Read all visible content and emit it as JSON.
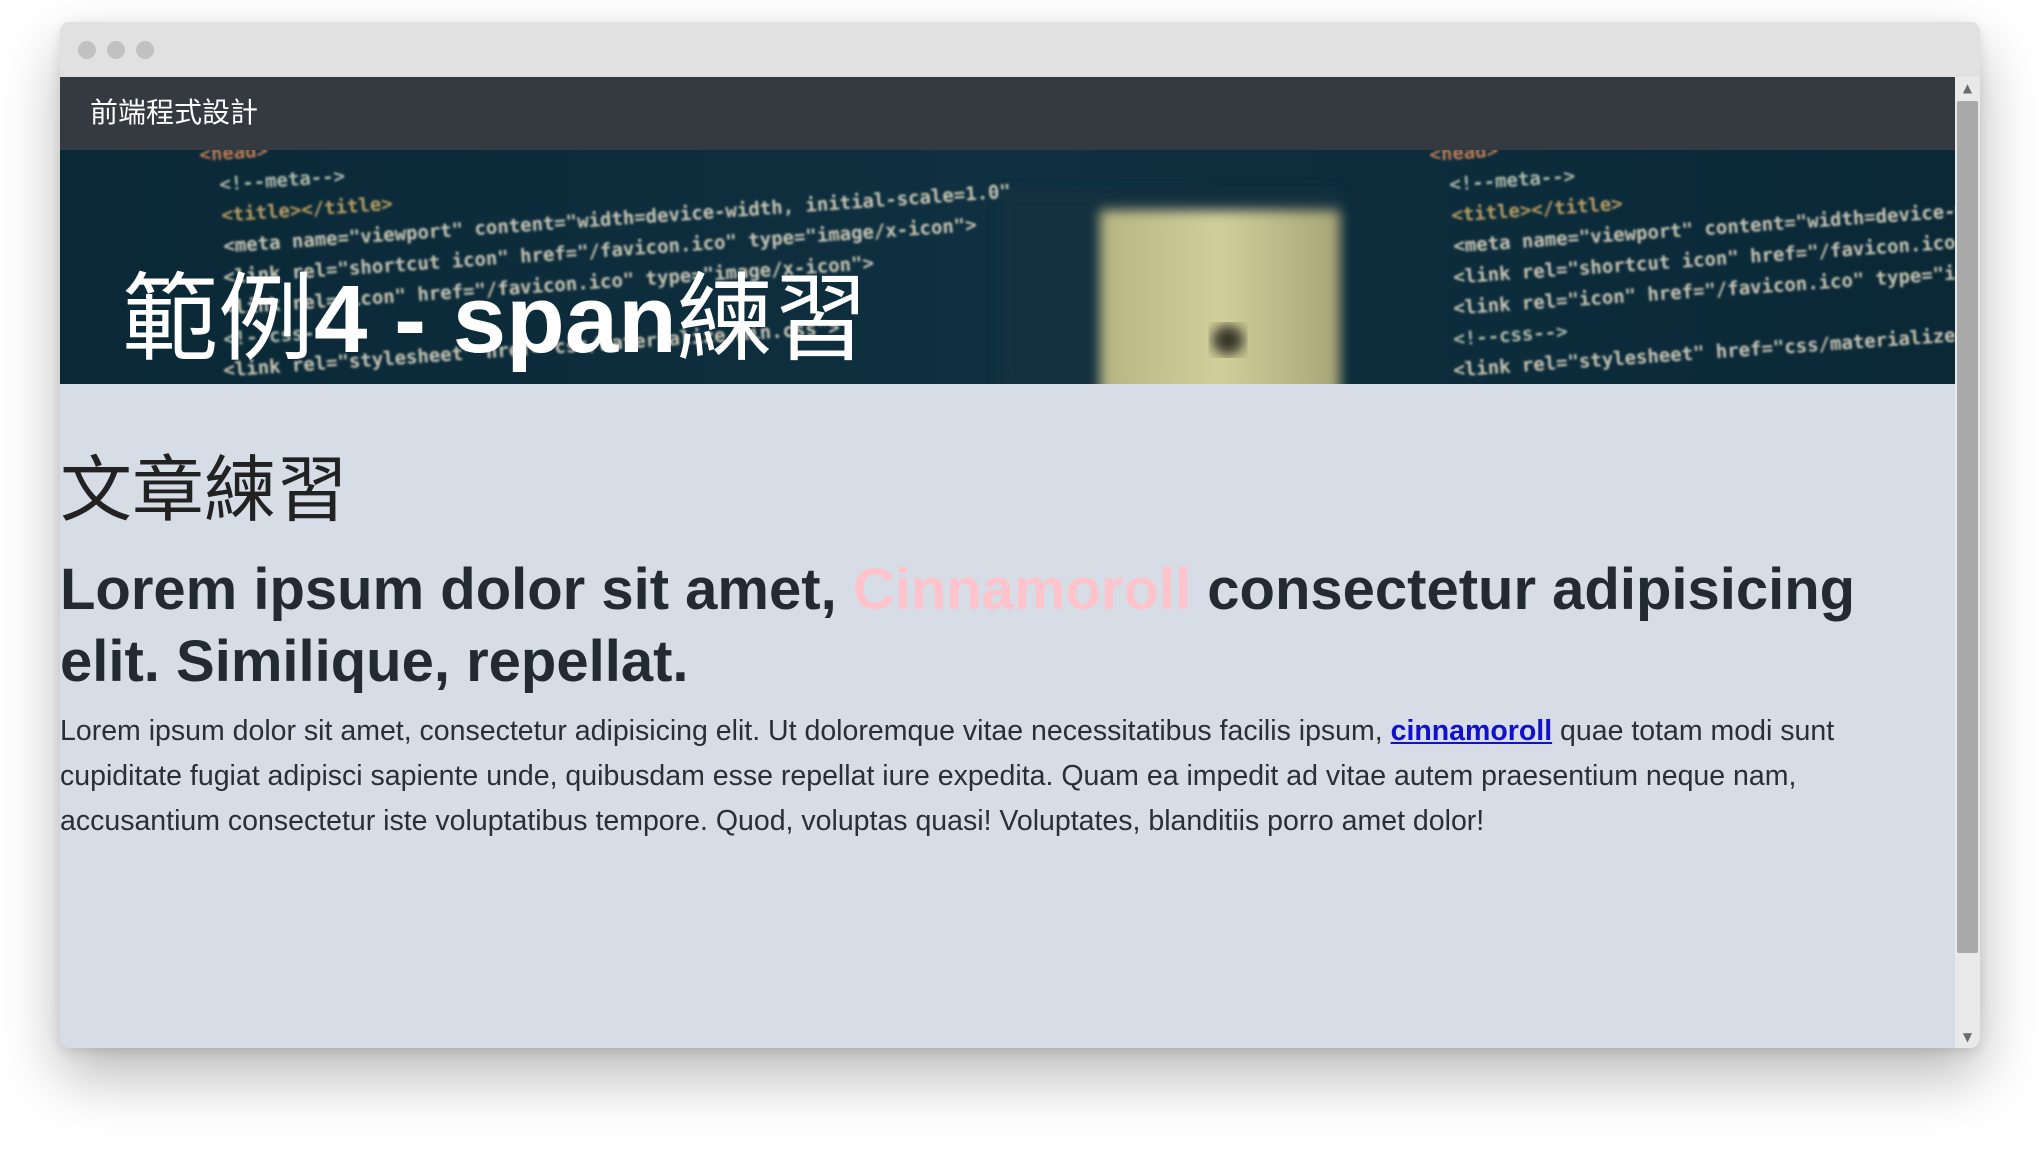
{
  "navbar": {
    "brand": "前端程式設計"
  },
  "hero": {
    "title_prefix": "範例",
    "title_number": "4 - span",
    "title_suffix": "練習"
  },
  "article": {
    "section_title": "文章練習",
    "headline_before": "Lorem ipsum dolor sit amet, ",
    "headline_highlight": "Cinnamoroll",
    "headline_after": " consectetur adipisicing elit. Similique, repellat.",
    "paragraph_before": "Lorem ipsum dolor sit amet, consectetur adipisicing elit. Ut doloremque vitae necessitatibus facilis ipsum, ",
    "paragraph_link": "cinnamoroll",
    "paragraph_after": " quae totam modi sunt cupiditate fugiat adipisci sapiente unde, quibusdam esse repellat iure expedita. Quam ea impedit ad vitae autem praesentium neque nam, accusantium consectetur iste voluptatibus tempore. Quod, voluptas quasi! Voluptates, blanditiis porro amet dolor!"
  },
  "hero_code_snippets": [
    "<head>",
    "<!--meta-->",
    "<title></title>",
    "<meta name=\"viewport\" content=\"width=device-width, initial-scale=1.0\">",
    "<link rel=\"shortcut icon\" href=\"/favicon.ico\" type=\"image/x-icon\">",
    "<link rel=\"icon\" href=\"/favicon.ico\" type=\"image/x-icon\">",
    "<!--css-->",
    "<link rel=\"stylesheet\" href=\"css/materialize.min.css\">"
  ],
  "colors": {
    "navbar_bg": "#343a40",
    "page_bg": "#d6dde6",
    "highlight_pink": "#ffc3cb",
    "link_blue": "#1111cc"
  },
  "scrollbar": {
    "up_icon": "triangle-up",
    "down_icon": "triangle-down"
  }
}
